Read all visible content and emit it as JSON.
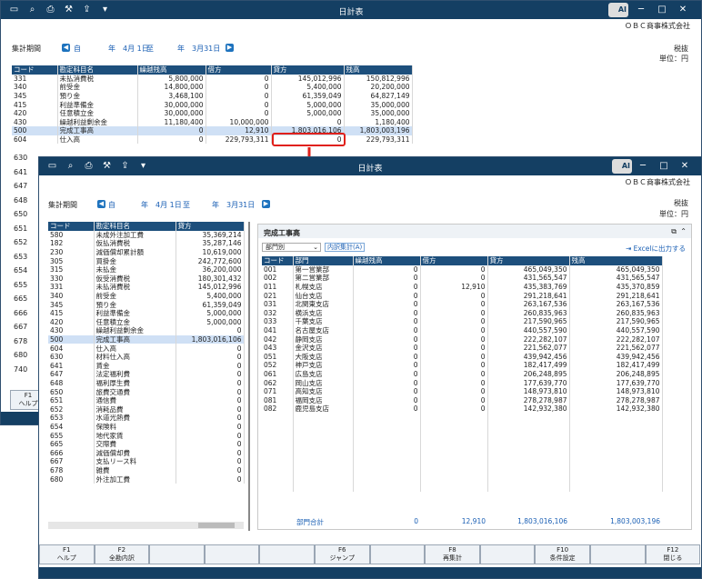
{
  "back": {
    "title": "日計表",
    "company": "ＯＢＣ商事株式会社",
    "period_label": "集計期間",
    "from_prefix": "自",
    "from_date": "年　4月 1日",
    "to_prefix": "至",
    "to_date": "年　3月31日",
    "tax": "税抜",
    "unit": "単位：円",
    "columns": [
      "コード",
      "勘定科目名",
      "繰越残高",
      "借方",
      "貸方",
      "残高"
    ],
    "rows": [
      [
        "331",
        "未払消費税",
        "5,800,000",
        "0",
        "145,012,996",
        "150,812,996"
      ],
      [
        "340",
        "前受金",
        "14,800,000",
        "0",
        "5,400,000",
        "20,200,000"
      ],
      [
        "345",
        "預り金",
        "3,468,100",
        "0",
        "61,359,049",
        "64,827,149"
      ],
      [
        "415",
        "利益準備金",
        "30,000,000",
        "0",
        "5,000,000",
        "35,000,000"
      ],
      [
        "420",
        "任意積立金",
        "30,000,000",
        "0",
        "5,000,000",
        "35,000,000"
      ],
      [
        "430",
        "繰越利益剰余金",
        "11,180,400",
        "10,000,000",
        "0",
        "1,180,400"
      ],
      [
        "500",
        "完成工事高",
        "0",
        "12,910",
        "1,803,016,106",
        "1,803,003,196"
      ],
      [
        "604",
        "仕入高",
        "0",
        "229,793,311",
        "0",
        "229,793,311"
      ]
    ],
    "more_codes": [
      "630",
      "641",
      "647",
      "648",
      "650",
      "651",
      "652",
      "653",
      "654",
      "655",
      "665",
      "666",
      "667",
      "678",
      "680",
      "740"
    ],
    "fkey_f1": "F1",
    "fkey_help": "ヘルプ"
  },
  "front": {
    "title": "日計表",
    "company": "ＯＢＣ商事株式会社",
    "period_label": "集計期間",
    "from_prefix": "自",
    "from_date": "年　4月 1日",
    "to_prefix": "至",
    "to_date": "年　3月31日",
    "tax": "税抜",
    "unit": "単位：円",
    "left_columns": [
      "コード",
      "勘定科目名",
      "貸方"
    ],
    "left_rows": [
      [
        "580",
        "未成外注加工費",
        "35,369,214"
      ],
      [
        "182",
        "仮払消費税",
        "35,287,146"
      ],
      [
        "230",
        "減価償却累計額",
        "10,619,000"
      ],
      [
        "305",
        "買掛金",
        "242,772,600"
      ],
      [
        "315",
        "未払金",
        "36,200,000"
      ],
      [
        "330",
        "仮受消費税",
        "180,301,432"
      ],
      [
        "331",
        "未払消費税",
        "145,012,996"
      ],
      [
        "340",
        "前受金",
        "5,400,000"
      ],
      [
        "345",
        "預り金",
        "61,359,049"
      ],
      [
        "415",
        "利益準備金",
        "5,000,000"
      ],
      [
        "420",
        "任意積立金",
        "5,000,000"
      ],
      [
        "430",
        "繰越利益剰余金",
        "0"
      ],
      [
        "500",
        "完成工事高",
        "1,803,016,106"
      ],
      [
        "604",
        "仕入高",
        "0"
      ],
      [
        "630",
        "材料仕入高",
        "0"
      ],
      [
        "641",
        "賃金",
        "0"
      ],
      [
        "647",
        "法定福利費",
        "0"
      ],
      [
        "648",
        "福利厚生費",
        "0"
      ],
      [
        "650",
        "旅費交通費",
        "0"
      ],
      [
        "651",
        "通信費",
        "0"
      ],
      [
        "652",
        "消耗品費",
        "0"
      ],
      [
        "653",
        "水道光熱費",
        "0"
      ],
      [
        "654",
        "保険料",
        "0"
      ],
      [
        "655",
        "地代家賃",
        "0"
      ],
      [
        "665",
        "交際費",
        "0"
      ],
      [
        "666",
        "減価償却費",
        "0"
      ],
      [
        "667",
        "支払リース料",
        "0"
      ],
      [
        "678",
        "雑費",
        "0"
      ],
      [
        "680",
        "外注加工費",
        "0"
      ]
    ],
    "panel_title": "完成工事高",
    "dept_select": "部門別",
    "breakdown_btn": "内訳集計(A)",
    "excel_link": "Excelに出力する",
    "right_columns": [
      "コード",
      "部門",
      "繰越残高",
      "借方",
      "貸方",
      "残高"
    ],
    "right_rows": [
      [
        "001",
        "第一営業部",
        "0",
        "0",
        "465,049,350",
        "465,049,350"
      ],
      [
        "002",
        "第二営業部",
        "0",
        "0",
        "431,565,547",
        "431,565,547"
      ],
      [
        "011",
        "札幌支店",
        "0",
        "12,910",
        "435,383,769",
        "435,370,859"
      ],
      [
        "021",
        "仙台支店",
        "0",
        "0",
        "291,218,641",
        "291,218,641"
      ],
      [
        "031",
        "北関東支店",
        "0",
        "0",
        "263,167,536",
        "263,167,536"
      ],
      [
        "032",
        "横浜支店",
        "0",
        "0",
        "260,835,963",
        "260,835,963"
      ],
      [
        "033",
        "千葉支店",
        "0",
        "0",
        "217,590,965",
        "217,590,965"
      ],
      [
        "041",
        "名古屋支店",
        "0",
        "0",
        "440,557,590",
        "440,557,590"
      ],
      [
        "042",
        "静岡支店",
        "0",
        "0",
        "222,282,107",
        "222,282,107"
      ],
      [
        "043",
        "金沢支店",
        "0",
        "0",
        "221,562,077",
        "221,562,077"
      ],
      [
        "051",
        "大阪支店",
        "0",
        "0",
        "439,942,456",
        "439,942,456"
      ],
      [
        "052",
        "神戸支店",
        "0",
        "0",
        "182,417,499",
        "182,417,499"
      ],
      [
        "061",
        "広島支店",
        "0",
        "0",
        "206,248,895",
        "206,248,895"
      ],
      [
        "062",
        "岡山支店",
        "0",
        "0",
        "177,639,770",
        "177,639,770"
      ],
      [
        "071",
        "高知支店",
        "0",
        "0",
        "148,973,810",
        "148,973,810"
      ],
      [
        "081",
        "福岡支店",
        "0",
        "0",
        "278,278,987",
        "278,278,987"
      ],
      [
        "082",
        "鹿児島支店",
        "0",
        "0",
        "142,932,380",
        "142,932,380"
      ]
    ],
    "totals": {
      "label": "部門合計",
      "carry": "0",
      "debit": "12,910",
      "credit": "1,803,016,106",
      "balance": "1,803,003,196"
    },
    "fkeys": [
      {
        "key": "F1",
        "label": "ヘルプ"
      },
      {
        "key": "F2",
        "label": "全勘内訳"
      },
      {
        "key": "",
        "label": ""
      },
      {
        "key": "",
        "label": ""
      },
      {
        "key": "",
        "label": ""
      },
      {
        "key": "F6",
        "label": "ジャンプ"
      },
      {
        "key": "",
        "label": ""
      },
      {
        "key": "F8",
        "label": "再集計"
      },
      {
        "key": "",
        "label": ""
      },
      {
        "key": "F10",
        "label": "条件設定"
      },
      {
        "key": "",
        "label": ""
      },
      {
        "key": "F12",
        "label": "閉じる"
      }
    ]
  },
  "colors": {
    "titlebar": "#143f63",
    "header": "#1d4f7c",
    "accent": "#e0201a",
    "link": "#1a5fb4"
  }
}
